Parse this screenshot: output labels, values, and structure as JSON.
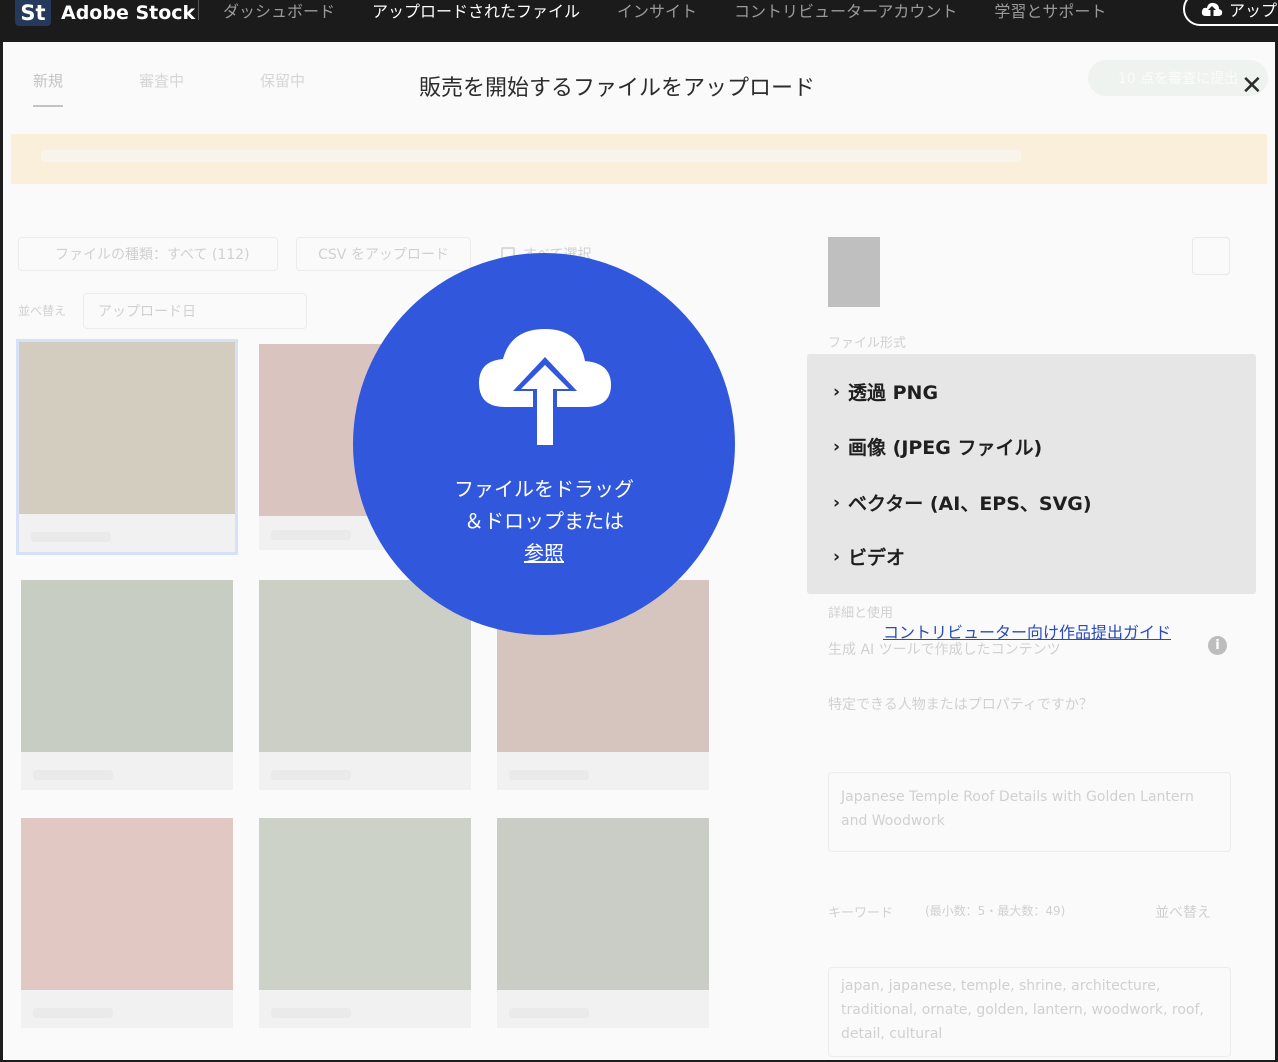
{
  "topbar": {
    "logo_mark": "St",
    "brand": "Adobe Stock",
    "nav": [
      {
        "label": "ダッシュボード",
        "active": false
      },
      {
        "label": "アップロードされたファイル",
        "active": true
      },
      {
        "label": "インサイト",
        "active": false
      },
      {
        "label": "コントリビューターアカウント",
        "active": false
      },
      {
        "label": "学習とサポート",
        "active": false
      }
    ],
    "upload_button": "アップ"
  },
  "background": {
    "tabs": [
      "新規",
      "審査中",
      "保留中"
    ],
    "submit_button": "10 点を審査に提出",
    "filter_button": "ファイルの種類：すべて (112)",
    "csv_button": "CSV をアップロード",
    "select_all": "すべて選択",
    "sort_label": "並べ替え",
    "sort_value": "アップロード日",
    "right_panel": {
      "file_format_label": "ファイル形式",
      "details_label": "詳細と使用",
      "gen_ai_label": "生成 AI ツールで作成したコンテンツ",
      "people_question": "特定できる人物またはプロパティですか？",
      "title_text": "Japanese Temple Roof Details with Golden Lantern and Woodwork",
      "keywords_label": "キーワード",
      "keywords_range": "(最小数：5・最大数：49)",
      "keywords_sort": "並べ替え",
      "keywords_text": "japan, japanese, temple, shrine, architecture, traditional, ornate, golden, lantern, woodwork, roof, detail, cultural"
    }
  },
  "modal": {
    "title": "販売を開始するファイルをアップロード",
    "close_glyph": "✕",
    "dropzone_line1": "ファイルをドラッグ",
    "dropzone_line2": "＆ドロップまたは",
    "dropzone_link": "参照",
    "file_types": [
      "透過 PNG",
      "画像 (JPEG ファイル)",
      "ベクター (AI、EPS、SVG)",
      "ビデオ"
    ],
    "guide_link": "コントリビューター向け作品提出ガイド",
    "info_glyph": "i"
  },
  "colors": {
    "dropzone": "#3158dc",
    "link": "#2a4bb8",
    "types_panel_bg": "#e6e6e6"
  }
}
